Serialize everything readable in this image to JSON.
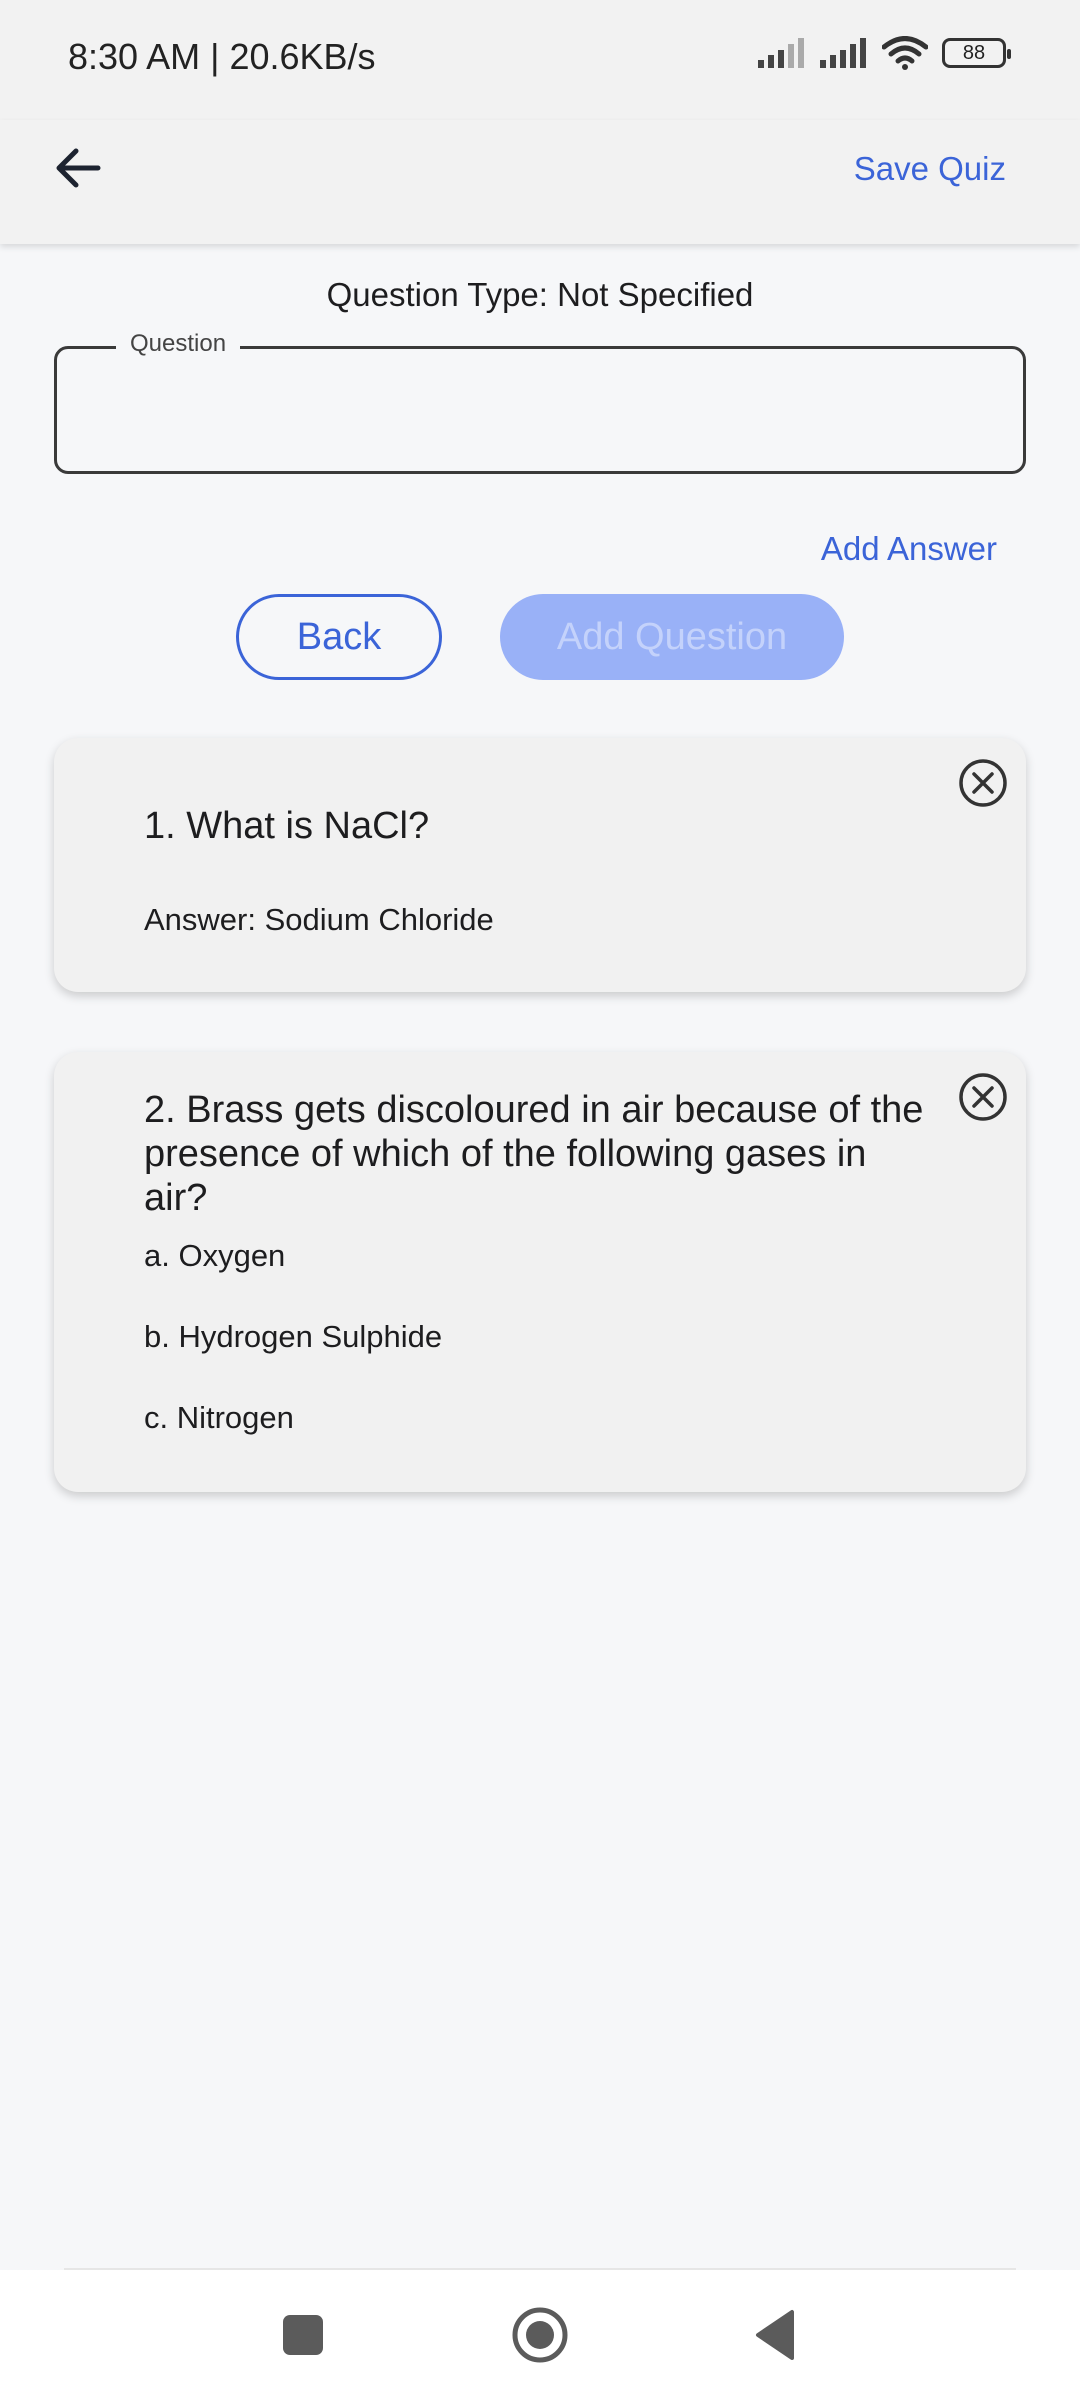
{
  "status_bar": {
    "time_speed": "8:30 AM | 20.6KB/s",
    "battery": "88",
    "icons": [
      "signal-icon",
      "signal-icon",
      "wifi-icon",
      "battery-icon"
    ]
  },
  "app_bar": {
    "back_icon": "arrow-left-icon",
    "save_label": "Save Quiz"
  },
  "form": {
    "question_type": "Question Type: Not Specified",
    "question_label": "Question",
    "question_value": "",
    "add_answer_label": "Add Answer",
    "back_label": "Back",
    "add_question_label": "Add Question"
  },
  "questions": [
    {
      "title": "1. What is NaCl?",
      "answer": "Answer: Sodium Chloride",
      "close_icon": "close-circle-icon"
    },
    {
      "title": "2. Brass gets discoloured in air because of the presence of which of the following gases in air?",
      "options": [
        "a. Oxygen",
        "b. Hydrogen Sulphide",
        "c. Nitrogen"
      ],
      "close_icon": "close-circle-icon"
    }
  ],
  "nav": {
    "icons": [
      "recents-icon",
      "home-icon",
      "back-icon"
    ]
  },
  "colors": {
    "accent": "#3b64d8",
    "disabled_button": "#99b1f7",
    "card_bg": "#f1f1f1",
    "page_bg": "#f6f7f9"
  }
}
